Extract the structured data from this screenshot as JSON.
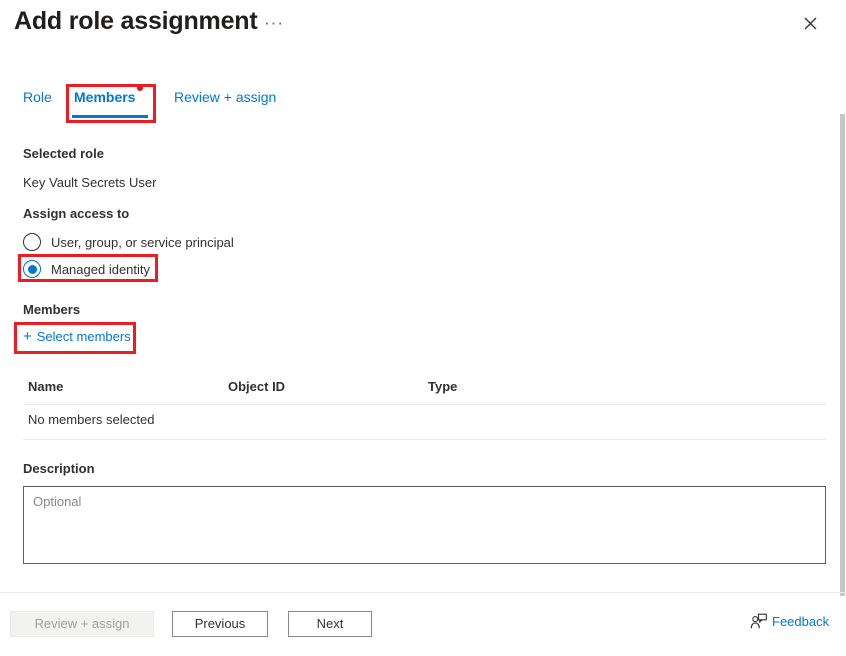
{
  "header": {
    "title": "Add role assignment",
    "ellipsis": "···",
    "close_icon": "close-icon"
  },
  "tabs": [
    {
      "label": "Role",
      "selected": false
    },
    {
      "label": "Members",
      "selected": true
    },
    {
      "label": "Review + assign",
      "selected": false
    }
  ],
  "selected_role": {
    "label": "Selected role",
    "value": "Key Vault Secrets User"
  },
  "assign_access": {
    "label": "Assign access to",
    "options": [
      {
        "label": "User, group, or service principal",
        "checked": false
      },
      {
        "label": "Managed identity",
        "checked": true
      }
    ]
  },
  "members": {
    "label": "Members",
    "select_link": "Select members",
    "plus_icon": "+",
    "columns": [
      "Name",
      "Object ID",
      "Type"
    ],
    "empty_text": "No members selected"
  },
  "description": {
    "label": "Description",
    "placeholder": "Optional",
    "value": ""
  },
  "footer": {
    "review_button": "Review + assign",
    "previous_button": "Previous",
    "next_button": "Next",
    "feedback_label": "Feedback"
  },
  "colors": {
    "accent": "#0078d4",
    "highlight": "#ec1c24",
    "dot": "#e81123",
    "text": "#323130",
    "disabled_text": "#a19f9d"
  }
}
